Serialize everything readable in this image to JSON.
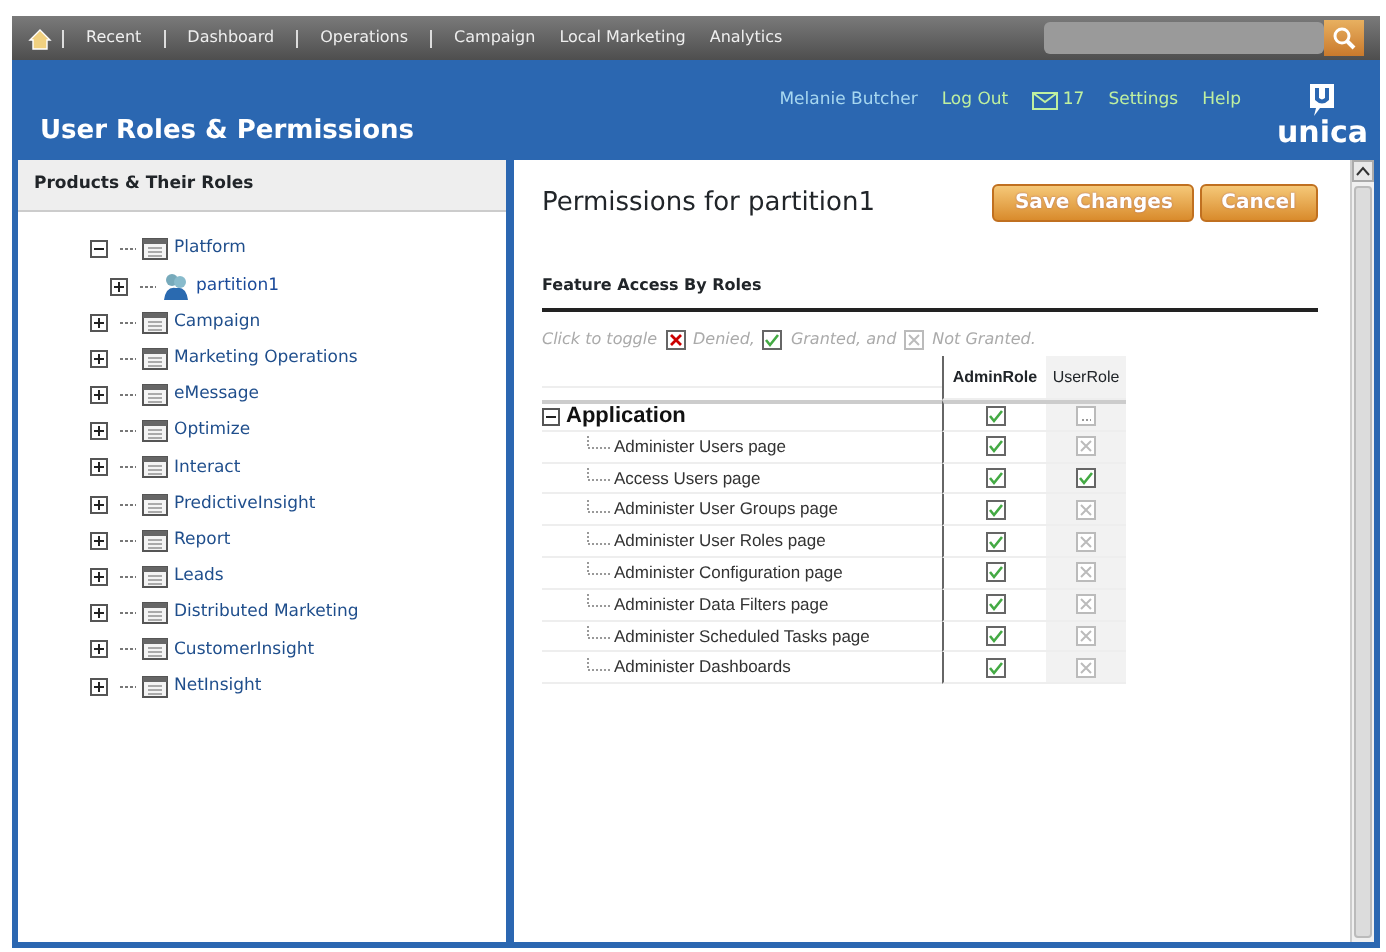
{
  "top_nav": {
    "items": [
      {
        "label": "Recent",
        "separated": true
      },
      {
        "label": "Dashboard",
        "separated": true
      },
      {
        "label": "Operations",
        "separated": true
      },
      {
        "label": "Campaign",
        "separated": false
      },
      {
        "label": "Local Marketing",
        "separated": false
      },
      {
        "label": "Analytics",
        "separated": false
      }
    ]
  },
  "header": {
    "title": "User Roles & Permissions",
    "user": "Melanie Butcher",
    "logout": "Log Out",
    "messages": "17",
    "settings": "Settings",
    "help": "Help",
    "logo": "unica"
  },
  "sidebar": {
    "title": "Products & Their Roles",
    "items": [
      {
        "label": "Platform",
        "expanded": true,
        "children": [
          {
            "label": "partition1",
            "expanded": false,
            "selected": true
          }
        ]
      },
      {
        "label": "Campaign",
        "expanded": false
      },
      {
        "label": "Marketing Operations",
        "expanded": false
      },
      {
        "label": "eMessage",
        "expanded": false
      },
      {
        "label": "Optimize",
        "expanded": false
      },
      {
        "label": "Interact",
        "expanded": false
      },
      {
        "label": "PredictiveInsight",
        "expanded": false
      },
      {
        "label": "Report",
        "expanded": false
      },
      {
        "label": "Leads",
        "expanded": false
      },
      {
        "label": "Distributed Marketing",
        "expanded": false
      },
      {
        "label": "CustomerInsight",
        "expanded": false
      },
      {
        "label": "NetInsight",
        "expanded": false
      }
    ]
  },
  "main": {
    "title": "Permissions for partition1",
    "buttons": [
      "Save Changes",
      "Cancel"
    ],
    "section": "Feature Access By Roles",
    "legend": {
      "intro": "Click to toggle",
      "items": [
        {
          "kind": "denied",
          "label": "Denied,"
        },
        {
          "kind": "granted",
          "label": "Granted, and"
        },
        {
          "kind": "ungranted",
          "label": "Not Granted."
        }
      ]
    },
    "columns": [
      "AdminRole",
      "UserRole"
    ],
    "group": {
      "label": "Application",
      "expanded": true,
      "cells": [
        {
          "kind": "granted"
        },
        {
          "kind": "mixed"
        }
      ]
    },
    "rows": [
      {
        "label": "Administer Users page",
        "cells": [
          {
            "kind": "granted"
          },
          {
            "kind": "ungranted"
          }
        ]
      },
      {
        "label": "Access Users page",
        "cells": [
          {
            "kind": "granted"
          },
          {
            "kind": "granted"
          }
        ]
      },
      {
        "label": "Administer User Groups page",
        "cells": [
          {
            "kind": "granted"
          },
          {
            "kind": "ungranted"
          }
        ]
      },
      {
        "label": "Administer User Roles page",
        "cells": [
          {
            "kind": "granted"
          },
          {
            "kind": "ungranted"
          }
        ]
      },
      {
        "label": "Administer Configuration page",
        "cells": [
          {
            "kind": "granted"
          },
          {
            "kind": "ungranted"
          }
        ]
      },
      {
        "label": "Administer Data Filters page",
        "cells": [
          {
            "kind": "granted"
          },
          {
            "kind": "ungranted"
          }
        ]
      },
      {
        "label": "Administer Scheduled Tasks page",
        "cells": [
          {
            "kind": "granted"
          },
          {
            "kind": "ungranted"
          }
        ]
      },
      {
        "label": "Administer Dashboards",
        "cells": [
          {
            "kind": "granted"
          },
          {
            "kind": "ungranted"
          }
        ]
      }
    ]
  }
}
